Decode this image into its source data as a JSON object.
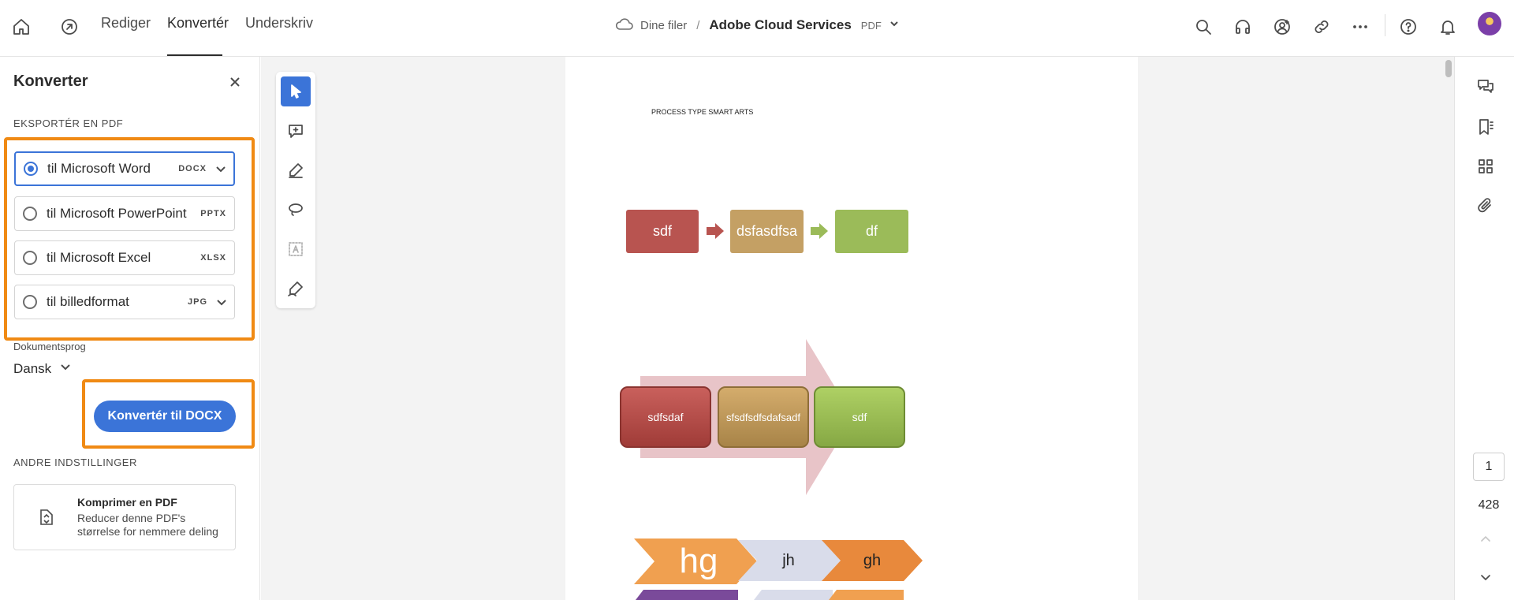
{
  "nav": {
    "tabs": [
      {
        "label": "Rediger"
      },
      {
        "label": "Konvertér"
      },
      {
        "label": "Underskriv"
      }
    ]
  },
  "breadcrumb": {
    "files": "Dine filer",
    "separator": "/",
    "doc_name": "Adobe Cloud Services",
    "doc_format": "PDF"
  },
  "panel": {
    "title": "Konverter",
    "export_section": "EKSPORTÉR EN PDF",
    "options": [
      {
        "label": "til Microsoft Word",
        "format": "DOCX",
        "selected": true
      },
      {
        "label": "til Microsoft PowerPoint",
        "format": "PPTX",
        "selected": false
      },
      {
        "label": "til Microsoft Excel",
        "format": "XLSX",
        "selected": false
      },
      {
        "label": "til billedformat",
        "format": "JPG",
        "selected": false
      }
    ],
    "language_label": "Dokumentsprog",
    "language_value": "Dansk",
    "convert_button": "Konvertér til DOCX",
    "other_section": "ANDRE INDSTILLINGER",
    "compress_card": {
      "title": "Komprimer en PDF",
      "description": "Reducer denne PDF's størrelse for nemmere deling"
    }
  },
  "document": {
    "heading": "PROCESS TYPE SMART ARTS",
    "process1": [
      "sdf",
      "dsfasdfsa",
      "df"
    ],
    "process2": [
      "sdfsdaf",
      "sfsdfsdfsdafsadf",
      "sdf"
    ],
    "process3": [
      "hg",
      "jh",
      "gh"
    ]
  },
  "pagination": {
    "current": "1",
    "total": "428"
  },
  "colors": {
    "accent": "#3b74d8",
    "highlight": "#f08a14",
    "box_red": "#b85450",
    "box_tan": "#c4a064",
    "box_green": "#9bbb59",
    "chevron_orange": "#f0a050"
  }
}
